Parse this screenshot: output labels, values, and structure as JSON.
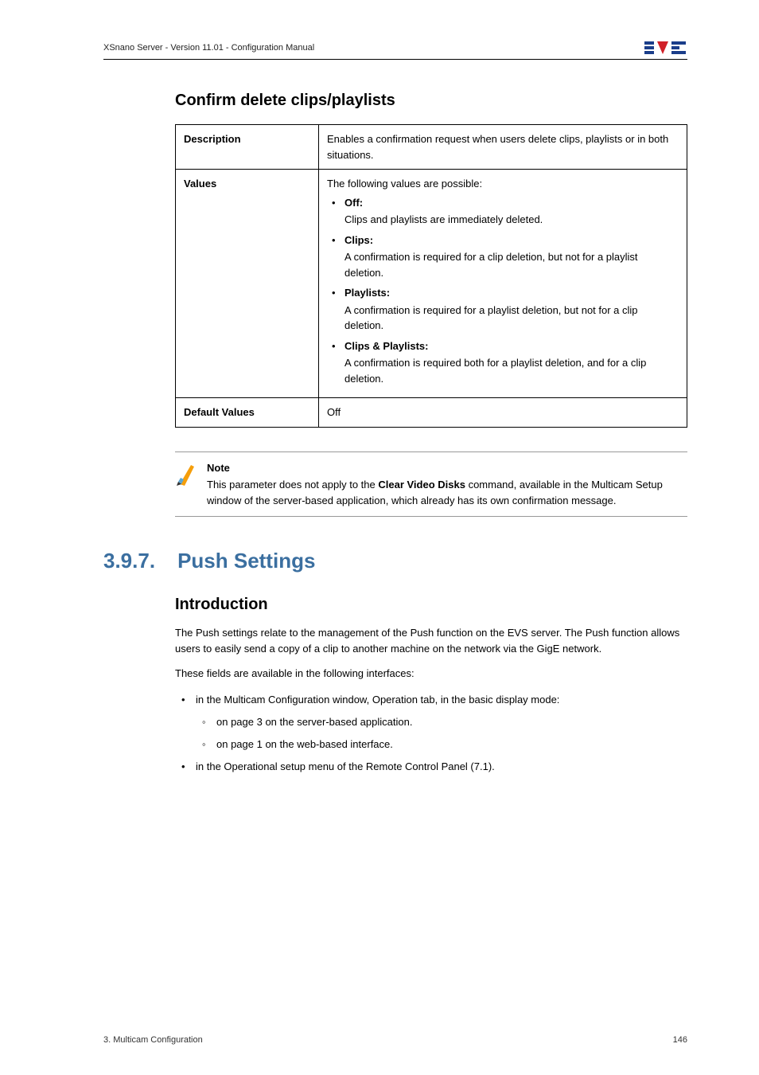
{
  "header": {
    "doc_title": "XSnano Server - Version 11.01 - Configuration Manual"
  },
  "section_confirm": {
    "heading": "Confirm delete clips/playlists",
    "row_description": {
      "label": "Description",
      "text": "Enables a confirmation request when users delete clips, playlists or in both situations."
    },
    "row_values": {
      "label": "Values",
      "intro": "The following values are possible:",
      "items": [
        {
          "name": "Off:",
          "desc": "Clips and playlists are immediately deleted."
        },
        {
          "name": "Clips:",
          "desc": "A confirmation is required for a clip deletion, but not for a playlist deletion."
        },
        {
          "name": "Playlists:",
          "desc": "A confirmation is required for a playlist deletion, but not for a clip deletion."
        },
        {
          "name": "Clips & Playlists:",
          "desc": "A confirmation is required both for a playlist deletion, and for a clip deletion."
        }
      ]
    },
    "row_default": {
      "label": "Default Values",
      "text": "Off"
    }
  },
  "note": {
    "title": "Note",
    "pre": "This parameter does not apply to the ",
    "bold": "Clear Video Disks",
    "post": " command, available in the Multicam Setup window of the server-based application, which already has its own confirmation message."
  },
  "chapter": {
    "number": "3.9.7.",
    "title": "Push Settings"
  },
  "intro": {
    "heading": "Introduction",
    "p1": "The Push settings relate to the management of the Push function on the EVS server. The Push function allows users to easily send a copy of a clip to another machine on the network via the GigE network.",
    "p2": "These fields are available in the following interfaces:",
    "list1": "in the Multicam Configuration window, Operation tab, in the basic display mode:",
    "sub1": "on page 3 on the server-based application.",
    "sub2": "on page 1 on the web-based interface.",
    "list2": "in the Operational setup menu of the Remote Control Panel (7.1)."
  },
  "footer": {
    "left": "3. Multicam Configuration",
    "right": "146"
  }
}
